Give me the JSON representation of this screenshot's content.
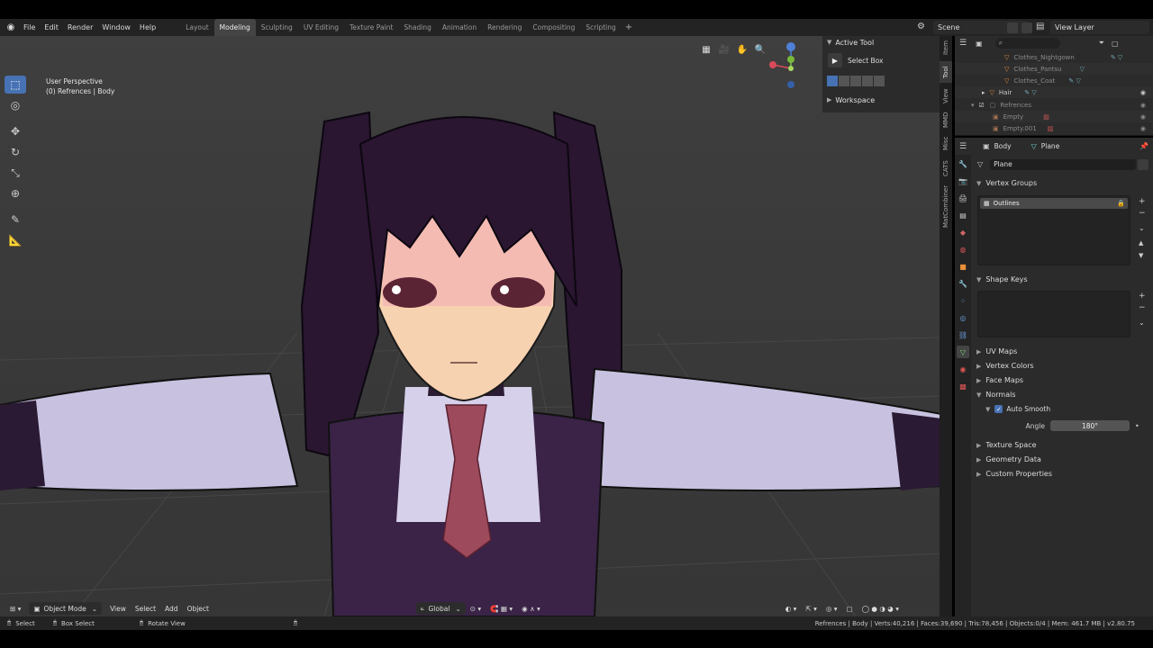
{
  "menu": {
    "items": [
      "File",
      "Edit",
      "Render",
      "Window",
      "Help"
    ],
    "workspaces": [
      "Layout",
      "Modeling",
      "Sculpting",
      "UV Editing",
      "Texture Paint",
      "Shading",
      "Animation",
      "Rendering",
      "Compositing",
      "Scripting"
    ],
    "active_workspace": "Modeling",
    "scene": "Scene",
    "view_layer": "View Layer"
  },
  "viewport": {
    "perspective": "User Perspective",
    "context": "(0) Refrences | Body",
    "mode": "Object Mode",
    "menus": [
      "View",
      "Select",
      "Add",
      "Object"
    ],
    "transform_orientation": "Global"
  },
  "npanel": {
    "active_tool_header": "Active Tool",
    "tool_name": "Select Box",
    "workspace_header": "Workspace",
    "tabs": [
      "Item",
      "Tool",
      "View",
      "MMD",
      "Misc",
      "CATS",
      "MatCombiner"
    ],
    "active_tab": "Tool"
  },
  "outliner": {
    "rows": [
      {
        "label": "Clothes_Nightgown"
      },
      {
        "label": "Clothes_Pantsu"
      },
      {
        "label": "Clothes_Coat"
      },
      {
        "label": "Hair"
      },
      {
        "label": "Refrences"
      },
      {
        "label": "Empty"
      },
      {
        "label": "Empty.001"
      }
    ]
  },
  "properties": {
    "object": "Body",
    "mesh": "Plane",
    "mesh_field": "Plane",
    "vertex_groups": "Vertex Groups",
    "vertex_group_item": "Outlines",
    "shape_keys": "Shape Keys",
    "uv_maps": "UV Maps",
    "vertex_colors": "Vertex Colors",
    "face_maps": "Face Maps",
    "normals": "Normals",
    "auto_smooth": "Auto Smooth",
    "angle_label": "Angle",
    "angle_value": "180°",
    "texture_space": "Texture Space",
    "geometry_data": "Geometry Data",
    "custom_properties": "Custom Properties"
  },
  "statusbar": {
    "select": "Select",
    "box_select": "Box Select",
    "rotate_view": "Rotate View",
    "stats": "Refrences | Body | Verts:40,216 | Faces:39,690 | Tris:78,456 | Objects:0/4 | Mem: 461.7 MB | v2.80.75"
  }
}
